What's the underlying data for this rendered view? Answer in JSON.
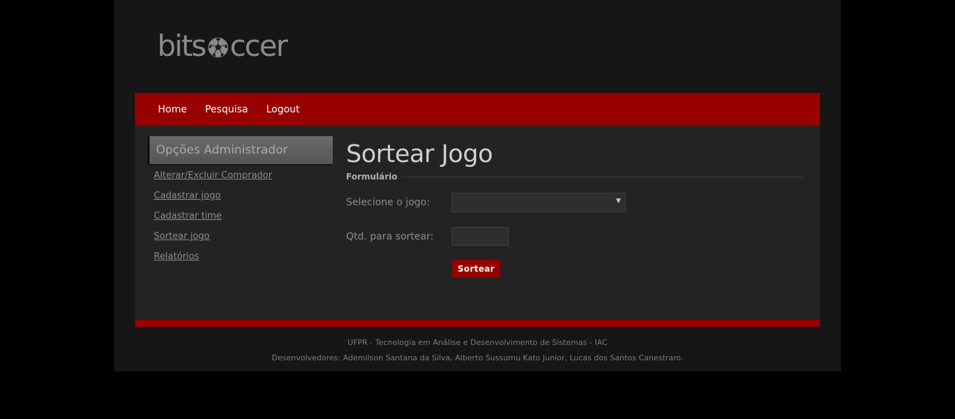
{
  "logo": {
    "text_before": "bits",
    "text_after": "ccer",
    "icon": "soccer-ball-icon"
  },
  "nav": {
    "items": [
      {
        "label": "Home"
      },
      {
        "label": "Pesquisa"
      },
      {
        "label": "Logout"
      }
    ]
  },
  "sidebar": {
    "title": "Opções Administrador",
    "links": [
      {
        "label": "Alterar/Excluir Comprador"
      },
      {
        "label": "Cadastrar jogo"
      },
      {
        "label": "Cadastrar time"
      },
      {
        "label": "Sortear jogo"
      },
      {
        "label": "Relatórios"
      }
    ]
  },
  "main": {
    "title": "Sortear Jogo",
    "legend": "Formulário",
    "game_label": "Selecione o jogo:",
    "game_selected": "",
    "qty_label": "Qtd. para sortear:",
    "qty_value": "",
    "submit_label": "Sortear"
  },
  "footer": {
    "line1": "UFPR - Tecnologia em Análise e Desenvolvimento de Sistemas - IAC",
    "line2": "Desenvolvedores: Ademilson Santana da Silva, Alberto Sussumu Kato Junior, Lucas dos Santos Canestraro."
  },
  "colors": {
    "brand_red": "#990000",
    "background": "#000000",
    "page": "#161616",
    "content": "#232323"
  }
}
